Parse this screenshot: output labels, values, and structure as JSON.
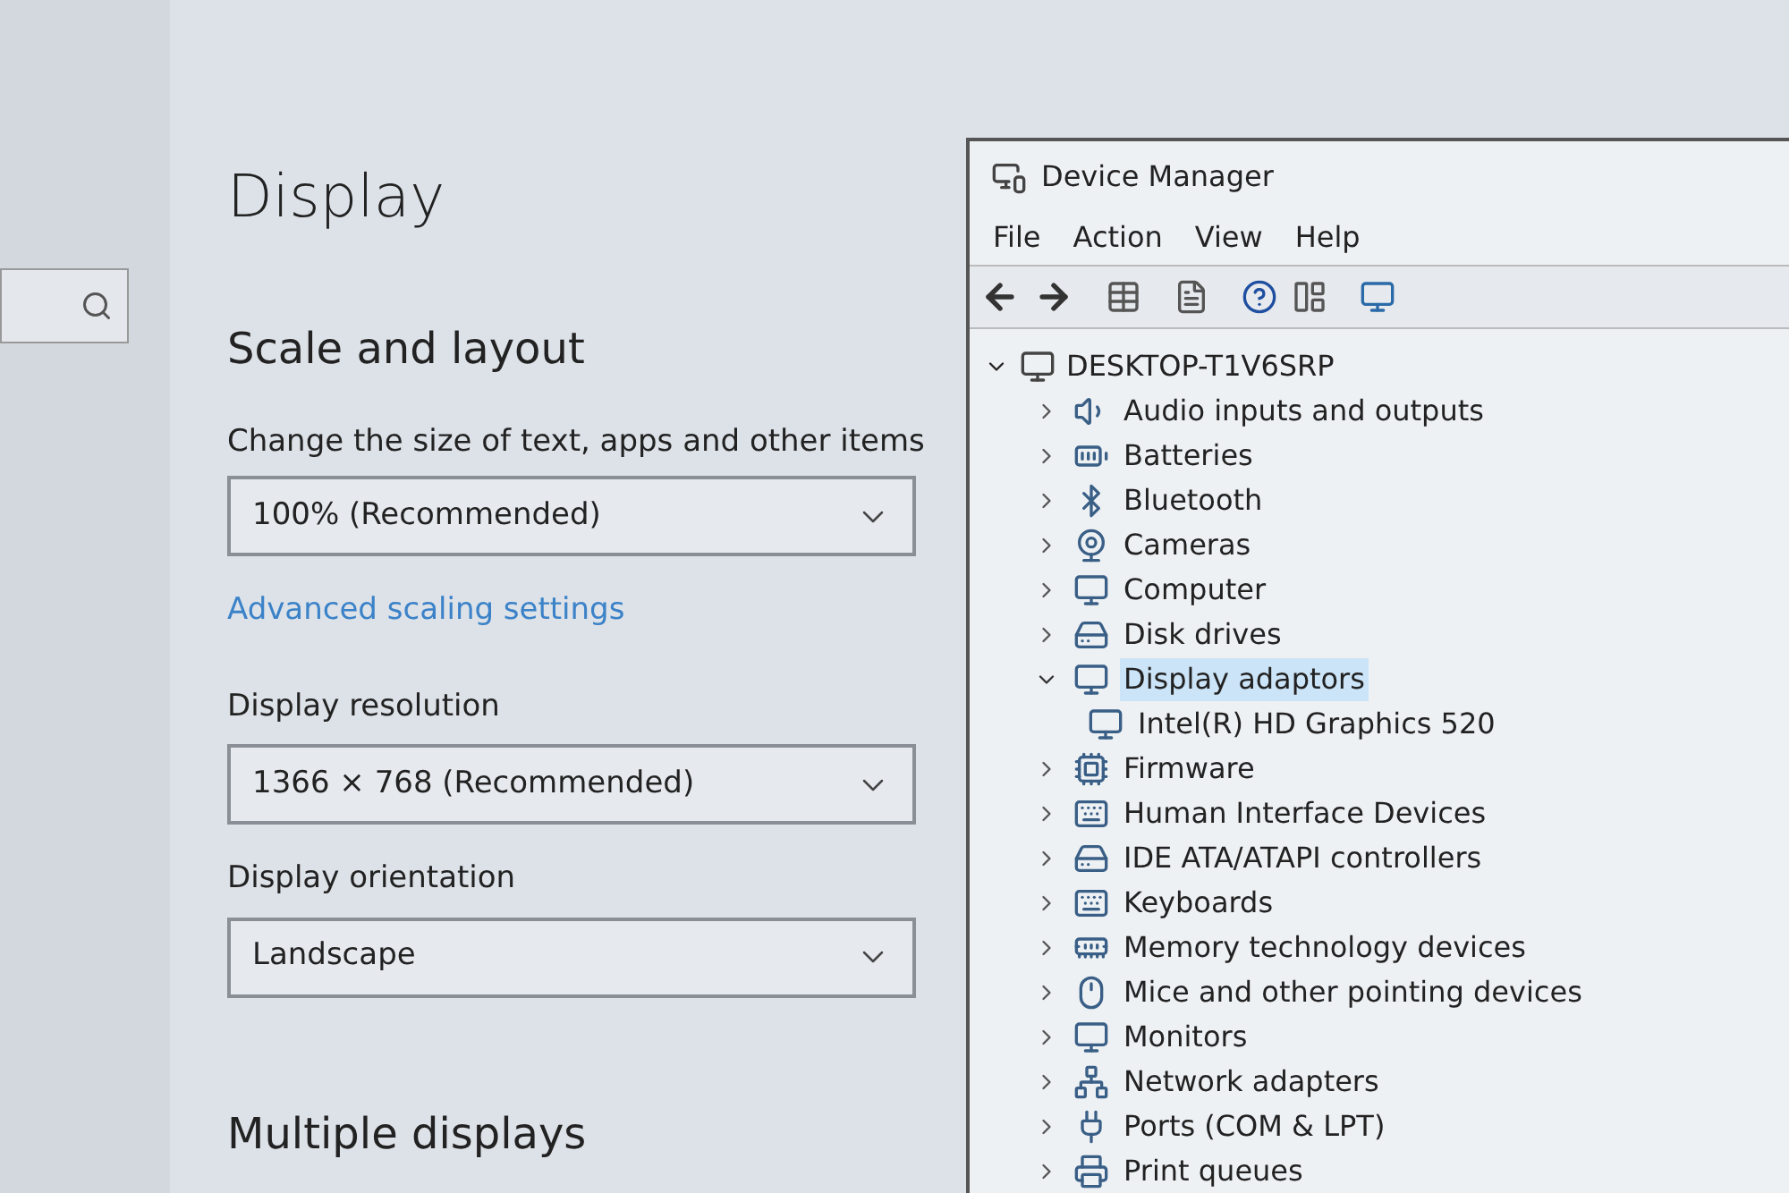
{
  "settings": {
    "title": "Display",
    "section_title": "Scale and layout",
    "scale": {
      "label": "Change the size of text, apps and other items",
      "value": "100% (Recommended)"
    },
    "advanced_link": "Advanced scaling settings",
    "resolution": {
      "label": "Display resolution",
      "value": "1366 × 768 (Recommended)"
    },
    "orientation": {
      "label": "Display orientation",
      "value": "Landscape"
    },
    "next_section_title": "Multiple displays"
  },
  "device_manager": {
    "window": {
      "title": "Device Manager"
    },
    "menu": [
      "File",
      "Action",
      "View",
      "Help"
    ],
    "tree": {
      "label": "DESKTOP-T1V6SRP",
      "expanded": true,
      "children": [
        {
          "label": "Audio inputs and outputs",
          "expanded": false
        },
        {
          "label": "Batteries",
          "expanded": false
        },
        {
          "label": "Bluetooth",
          "expanded": false
        },
        {
          "label": "Cameras",
          "expanded": false
        },
        {
          "label": "Computer",
          "expanded": false
        },
        {
          "label": "Disk drives",
          "expanded": false
        },
        {
          "label": "Display adaptors",
          "expanded": true,
          "selected": true,
          "children": [
            {
              "label": "Intel(R) HD Graphics 520"
            }
          ]
        },
        {
          "label": "Firmware",
          "expanded": false
        },
        {
          "label": "Human Interface Devices",
          "expanded": false
        },
        {
          "label": "IDE ATA/ATAPI controllers",
          "expanded": false
        },
        {
          "label": "Keyboards",
          "expanded": false
        },
        {
          "label": "Memory technology devices",
          "expanded": false
        },
        {
          "label": "Mice and other pointing devices",
          "expanded": false
        },
        {
          "label": "Monitors",
          "expanded": false
        },
        {
          "label": "Network adapters",
          "expanded": false
        },
        {
          "label": "Ports (COM & LPT)",
          "expanded": false
        },
        {
          "label": "Print queues",
          "expanded": false
        }
      ]
    }
  }
}
